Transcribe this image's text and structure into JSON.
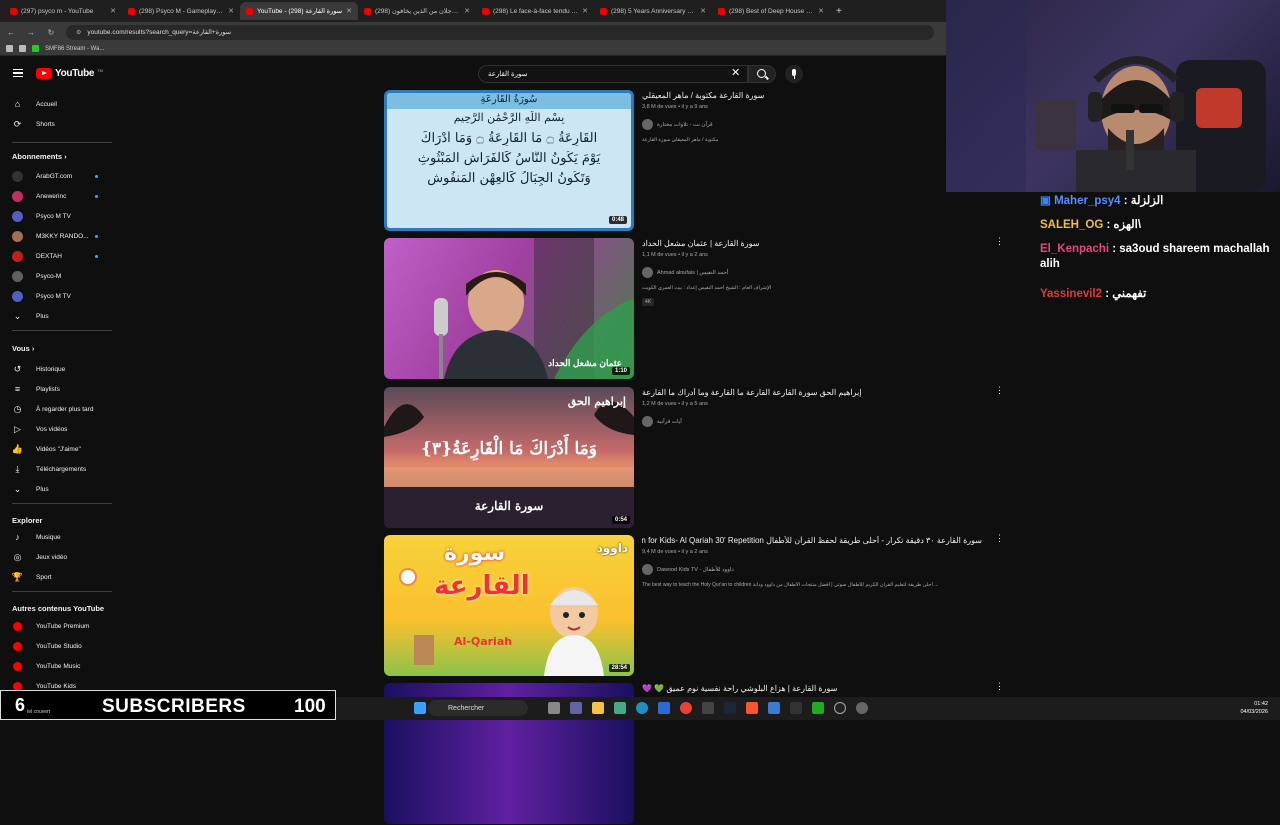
{
  "browser": {
    "tabs": [
      {
        "title": "(297) psyco m - YouTube",
        "active": false
      },
      {
        "title": "(298) Psyco M - Gameplay Strat",
        "active": false
      },
      {
        "title": "YouTube - سورة القارعة (298)",
        "active": true
      },
      {
        "title": "(298) قال رجلان من الذين يخافون",
        "active": false
      },
      {
        "title": "(298) Le face-à-face tendu entre",
        "active": false
      },
      {
        "title": "(298) 5 Years Anniversary Spec",
        "active": false
      },
      {
        "title": "(298) Best of Deep House [2026",
        "active": false
      }
    ],
    "new_tab": "+",
    "url": "youtube.com/results?search_query=سورة+القارعة",
    "bookmark": "SMF86 Stream - Wa..."
  },
  "masthead": {
    "logo_text": "YouTube",
    "logo_tm": "TM",
    "search_value": "سورة القارعة",
    "clear": "✕"
  },
  "sidebar": {
    "top": [
      {
        "label": "Accueil",
        "icon": "home-icon",
        "glyph": "⌂"
      },
      {
        "label": "Shorts",
        "icon": "shorts-icon",
        "glyph": "⟳"
      }
    ],
    "subs_head": "Abonnements ›",
    "subs": [
      {
        "label": "ArabGT.com",
        "color": "#333333",
        "dot": true
      },
      {
        "label": "Anewerinc",
        "color": "#c03060",
        "dot": true
      },
      {
        "label": "Psyco M TV",
        "color": "#5060c0",
        "dot": false
      },
      {
        "label": "M3KKY RANDO...",
        "color": "#a07050",
        "dot": true
      },
      {
        "label": "DEXTAH",
        "color": "#c02020",
        "dot": true
      },
      {
        "label": "Psyco-M",
        "color": "#606060",
        "dot": false
      },
      {
        "label": "Psyco M TV",
        "color": "#5060c0",
        "dot": false
      }
    ],
    "subs_more": "Plus",
    "you_head": "Vous ›",
    "you": [
      {
        "label": "Historique",
        "glyph": "↺",
        "icon": "history-icon"
      },
      {
        "label": "Playlists",
        "glyph": "≡",
        "icon": "playlist-icon"
      },
      {
        "label": "À regarder plus tard",
        "glyph": "◷",
        "icon": "clock-icon"
      },
      {
        "label": "Vos vidéos",
        "glyph": "▷",
        "icon": "video-icon"
      },
      {
        "label": "Vidéos \"J'aime\"",
        "glyph": "👍",
        "icon": "like-icon"
      },
      {
        "label": "Téléchargements",
        "glyph": "⤓",
        "icon": "download-icon"
      }
    ],
    "you_more": "Plus",
    "explore_head": "Explorer",
    "explore": [
      {
        "label": "Musique",
        "glyph": "♪",
        "icon": "music-icon"
      },
      {
        "label": "Jeux vidéo",
        "glyph": "◎",
        "icon": "gaming-icon"
      },
      {
        "label": "Sport",
        "glyph": "🏆",
        "icon": "trophy-icon"
      }
    ],
    "more_head": "Autres contenus YouTube",
    "more": [
      {
        "label": "YouTube Premium"
      },
      {
        "label": "YouTube Studio"
      },
      {
        "label": "YouTube Music"
      },
      {
        "label": "YouTube Kids"
      }
    ]
  },
  "results": [
    {
      "title": "سورة القارعة مكتوبة / ماهر المعيقلي",
      "meta": "3,8 M de vues • il y a 9 ans",
      "channel": "قرآن نت - تلاوات مختارة",
      "desc": "مكتوبة / ماهر المعيقلي سورة القارعة",
      "duration": "0:48",
      "badge": "",
      "thumb_lines": [
        "سُورَةُ القَارِعَةِ",
        "بِسْمِ اللَّهِ الرَّحْمَٰنِ الرَّحِيمِ",
        "الْقَارِعَةُ ۝ مَا الْقَارِعَةُ ۝ وَمَا أَدْرَاكَ",
        "يَوْمَ يَكُونُ النَّاسُ كَالْفَرَاشِ الْمَبْثُوثِ",
        "وَتَكُونُ الْجِبَالُ كَالْعِهْنِ الْمَنفُوشِ"
      ]
    },
    {
      "title": "سورة القارعة | عثمان مشعل الحداد",
      "meta": "1,1 M de vues • il y a 2 ans",
      "channel": "Ahmad alnufais | أحمد النفيس",
      "desc": "الإشراف العام : الشيخ أحمد النفيس إعداد : بيت العمري الكويت",
      "duration": "1:10",
      "badge": "4K",
      "thumb_lines": [
        "عثمان مشعل الحداد"
      ]
    },
    {
      "title": "إبراهيم الحق سورة القارعة القارعة ما القارعة وما أدراك ما القارعة",
      "meta": "1,2 M de vues • il y a 5 ans",
      "channel": "آيات قرآنية",
      "desc": "",
      "duration": "0:54",
      "badge": "",
      "thumb_lines": [
        "إبراهيم الحق",
        "وَمَا أَدْرَاكَ مَا الْقَارِعَةُ{٣}",
        "سورة القارعة"
      ]
    },
    {
      "title": "سورة القارعة ٣٠ دقيقة تكرار - أحلى طريقة لحفظ القرآن للأطفال Quran for Kids- Al Qariah 30' Repetition",
      "meta": "9,4 M de vues • il y a 2 ans",
      "channel": "Dawood Kids TV - داوود للأطفال",
      "desc": "The best way to teach the Holy Qur'an to children أحلى طريقة لتعليم القرآن الكريم للأطفال صوتي | أفضل منتجات الأطفال من داوود ودانة ...",
      "duration": "28:54",
      "badge": "",
      "thumb_lines": [
        "سورة",
        "القارعة",
        "Al-Qariah",
        "داوود"
      ]
    },
    {
      "title": "سورة القارعة | هزاع البلوشي راحة نفسية نوم عميق 💚 💜",
      "meta": "",
      "channel": "",
      "desc": "",
      "duration": "",
      "badge": "",
      "thumb_lines": []
    }
  ],
  "chat": [
    {
      "user": "الزلزلة",
      "sep": " : ",
      "msg": "Maher_psy4",
      "user_color": "#ffffff",
      "msg_color": "#5b8cff",
      "reverse": true
    },
    {
      "user": "SALEH_OG",
      "sep": " : ",
      "msg": "الهزه\\",
      "user_color": "#f0c040",
      "msg_color": "#ffffff",
      "reverse": false
    },
    {
      "user": "El_Kenpachi",
      "sep": " : ",
      "msg": "sa3oud shareem machallah alih",
      "user_color": "#e04a7a",
      "msg_color": "#ffffff",
      "reverse": false
    },
    {
      "user": "Yassinevil2",
      "sep": " : ",
      "msg": "تفهمني",
      "user_color": "#e03a3a",
      "msg_color": "#ffffff",
      "reverse": false
    }
  ],
  "overlay": {
    "count_prefix": "6",
    "count_sub": "tel couvert",
    "label": "SUBSCRIBERS",
    "goal": "100"
  },
  "taskbar": {
    "search": "Rechercher",
    "time": "01:42",
    "date": "04/03/2026"
  }
}
